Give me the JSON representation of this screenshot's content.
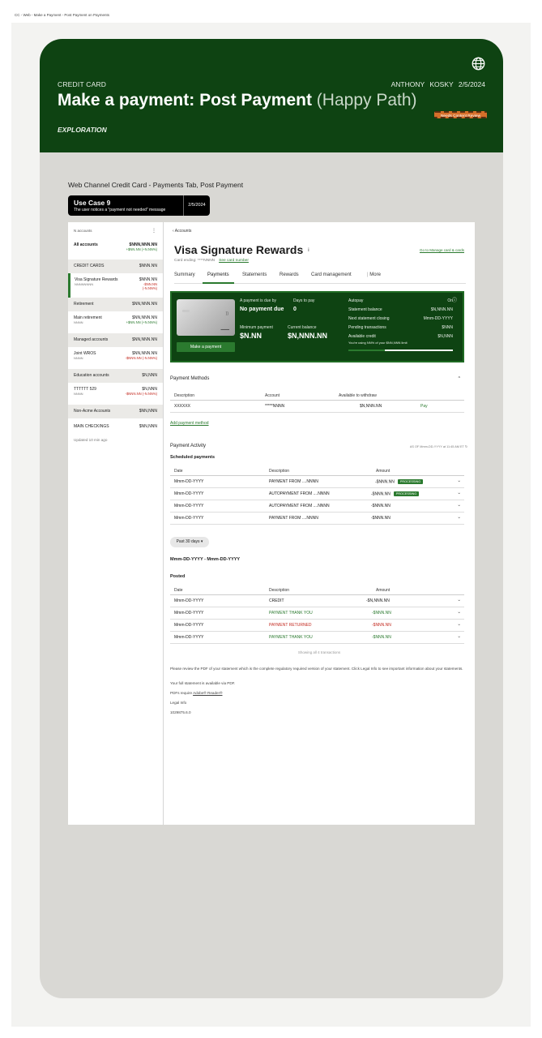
{
  "page_label": "CC - Web - Make a Payment - Post Payment on Payments",
  "hero": {
    "eyebrow": "CREDIT CARD",
    "author": "ANTHONY KOSKY",
    "date": "2/5/2024",
    "title_main": "Make a payment: Post Payment",
    "title_light": "(Happy Path)",
    "review_badge": "Needs Content Review",
    "tag": "EXPLORATION"
  },
  "subtitle": "Web Channel Credit Card - Payments Tab, Post Payment",
  "use_case": {
    "title": "Use Case 9",
    "description": "The user notices a \"payment not needed\" message",
    "date": "2/5/2024"
  },
  "sidebar": {
    "count": "N accounts",
    "all_accounts": {
      "label": "All accounts",
      "value": "$NNN,NNN.NN",
      "change": "+$NN.NN (+N.NN%)"
    },
    "credit_cards": {
      "label": "CREDIT CARDS",
      "value": "$NNN.NN"
    },
    "visa": {
      "label": "Visa Signature Rewards",
      "sub": "NNNNNNNN",
      "value": "$NNN.NN",
      "change1": "-$NN.NN",
      "change2": "(-N.NN%)"
    },
    "retirement": {
      "label": "Retirement",
      "value": "$NN,NNN.NN"
    },
    "main_retirement": {
      "label": "Main retirement",
      "sub": "NNNN",
      "value": "$NN,NNN.NN",
      "change": "+$NN.NN (+N.NN%)"
    },
    "managed": {
      "label": "Managed accounts",
      "value": "$NN,NNN.NN"
    },
    "joint": {
      "label": "Joint WROS",
      "sub": "NNNN",
      "value": "$NN,NNN.NN",
      "change": "-$NNN.NN (-N.NN%)"
    },
    "education": {
      "label": "Education accounts",
      "value": "$N,NNN"
    },
    "ttt": {
      "label": "TTTTTT 529",
      "sub": "NNNN",
      "value": "$N,NNN",
      "change": "-$NNN.NN (-N.NN%)"
    },
    "non_acme": {
      "label": "Non-Acme Accounts",
      "value": "$NN,NNN"
    },
    "main_checking": {
      "label": "MAIN CHECKINGS",
      "value": "$NN,NNN"
    },
    "updated": "Updated 10 min ago"
  },
  "main": {
    "breadcrumb": "Accounts",
    "title": "Visa Signature Rewards",
    "info_icon": "i",
    "manage_link": "Go to Manage card & cards",
    "card_ending": "Card ending: ****NNNN",
    "see_number": "See card number",
    "tabs": [
      "Summary",
      "Payments",
      "Statements",
      "Rewards",
      "Card management",
      "More"
    ],
    "active_tab": "Payments"
  },
  "summary": {
    "make_payment": "Make a payment",
    "due_by_label": "A payment is due by",
    "due_by_value": "No payment due",
    "days_label": "Days to pay",
    "days_value": "0",
    "min_label": "Minimum payment",
    "min_value": "$N.NN",
    "balance_label": "Current balance",
    "balance_value": "$N,NNN.NN",
    "autopay_label": "Autopay",
    "autopay_value": "On",
    "stmt_balance_label": "Statement balance",
    "stmt_balance_value": "$N,NNN.NN",
    "next_closing_label": "Next statement closing",
    "next_closing_value": "Mmm-DD-YYYY",
    "pending_label": "Pending transactions",
    "pending_value": "$NNN",
    "avail_label": "Available credit",
    "avail_value": "$N,NNN",
    "usage_note": "You're using NN% of your $NN,NNN limit",
    "usage_fraction": 0.35
  },
  "payment_methods": {
    "heading": "Payment Methods",
    "columns": [
      "Description",
      "Account",
      "Available to withdraw"
    ],
    "rows": [
      {
        "description": "XXXXXX",
        "account": "*****NNNN",
        "available": "$N,NNN.NN",
        "action": "Pay"
      }
    ],
    "add_link": "Add payment method"
  },
  "payment_activity": {
    "heading": "Payment Activity",
    "as_of": "AS OF Mmm-DD-YYYY at 11:45 AM ET",
    "scheduled_heading": "Scheduled payments",
    "columns": [
      "Date",
      "Description",
      "Amount"
    ],
    "scheduled": [
      {
        "date": "Mmm-DD-YYYY",
        "description": "PAYMENT FROM ....NNNN",
        "amount": "-$NNN.NN",
        "status": "PROCESSING"
      },
      {
        "date": "Mmm-DD-YYYY",
        "description": "AUTOPAYMENT FROM ....NNNN",
        "amount": "-$NNN.NN",
        "status": "PROCESSING"
      },
      {
        "date": "Mmm-DD-YYYY",
        "description": "AUTOPAYMENT FROM ....NNNN",
        "amount": "-$NNN.NN",
        "status": ""
      },
      {
        "date": "Mmm-DD-YYYY",
        "description": "PAYMENT FROM ....NNNN",
        "amount": "-$NNN.NN",
        "status": ""
      }
    ],
    "filter": "Past 30 days",
    "range": "Mmm-DD-YYYY - Mmm-DD-YYYY",
    "posted_heading": "Posted",
    "posted": [
      {
        "date": "Mmm-DD-YYYY",
        "description": "CREDIT",
        "amount": "-$N,NNN.NN",
        "tone": "default"
      },
      {
        "date": "Mmm-DD-YYYY",
        "description": "PAYMENT THANK YOU",
        "amount": "-$NNN.NN",
        "tone": "green"
      },
      {
        "date": "Mmm-DD-YYYY",
        "description": "PAYMENT RETURNED",
        "amount": "-$NNN.NN",
        "tone": "red"
      },
      {
        "date": "Mmm-DD-YYYY",
        "description": "PAYMENT THANK YOU",
        "amount": "-$NNN.NN",
        "tone": "green"
      }
    ],
    "showing": "Showing all 4 transactions"
  },
  "footer": {
    "p1": "Please review the PDF of your statement which is the complete regulatory required version of your statement. Click Legal Info to see important information about your statements.",
    "p2": "Your full statement is available via PDF.",
    "p3_prefix": "PDFs require ",
    "p3_link": "Adobe® Reader®",
    "legal": "Legal Info",
    "code": "1029875.6.0"
  },
  "colors": {
    "brand_green": "#0e4312",
    "accent_green": "#2b7a2f",
    "alert_red": "#c3291f",
    "review_orange": "#d56f2a"
  }
}
